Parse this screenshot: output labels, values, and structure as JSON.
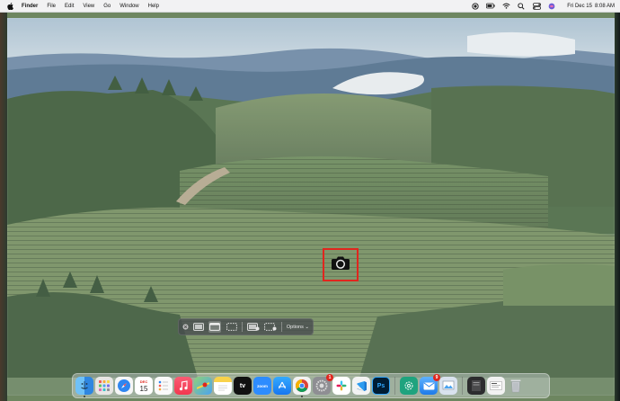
{
  "menubar": {
    "app_name": "Finder",
    "items": [
      "File",
      "Edit",
      "View",
      "Go",
      "Window",
      "Help"
    ],
    "clock": {
      "date": "Fri Dec 15",
      "time": "8:08 AM"
    }
  },
  "toolbar": {
    "options_label": "Options"
  },
  "dock": {
    "apps": [
      {
        "name": "finder-icon",
        "color": "#4aa3f0"
      },
      {
        "name": "launchpad-icon",
        "color": "#e9e6e2"
      },
      {
        "name": "safari-icon",
        "color": "#2f7ff0"
      },
      {
        "name": "calendar-icon",
        "color": "#ffffff",
        "label": "15",
        "top": "DEC"
      },
      {
        "name": "reminders-icon",
        "color": "#f4f4f4"
      },
      {
        "name": "music-icon",
        "color": "#f5405a"
      },
      {
        "name": "maps-icon",
        "color": "#62c25a"
      },
      {
        "name": "notes-icon",
        "color": "#f9d24a"
      },
      {
        "name": "apple-tv-icon",
        "color": "#111111",
        "label": "tv"
      },
      {
        "name": "zoom-icon",
        "color": "#2d8cff",
        "label": "zoom"
      },
      {
        "name": "app-store-icon",
        "color": "#1e90ff"
      },
      {
        "name": "chrome-icon",
        "color": "#f3f3f3"
      },
      {
        "name": "system-settings-icon",
        "color": "#8e8e93"
      },
      {
        "name": "slack-icon",
        "color": "#ffffff"
      },
      {
        "name": "vscode-icon",
        "color": "#1e7ad2"
      },
      {
        "name": "photoshop-icon",
        "color": "#001d34",
        "label": "Ps"
      },
      {
        "name": "chatgpt-icon",
        "color": "#1fa37e"
      },
      {
        "name": "mail-icon",
        "color": "#2e8ff0"
      },
      {
        "name": "preview-icon",
        "color": "#cfd8e6"
      },
      {
        "name": "downloads-stack-icon",
        "color": "#3a3a3c"
      },
      {
        "name": "recent-document-icon",
        "color": "#f2f2f2"
      },
      {
        "name": "trash-icon",
        "color": "#c9ccd0"
      }
    ],
    "badges": {
      "system-settings-icon": "1",
      "mail-icon": "9"
    }
  }
}
